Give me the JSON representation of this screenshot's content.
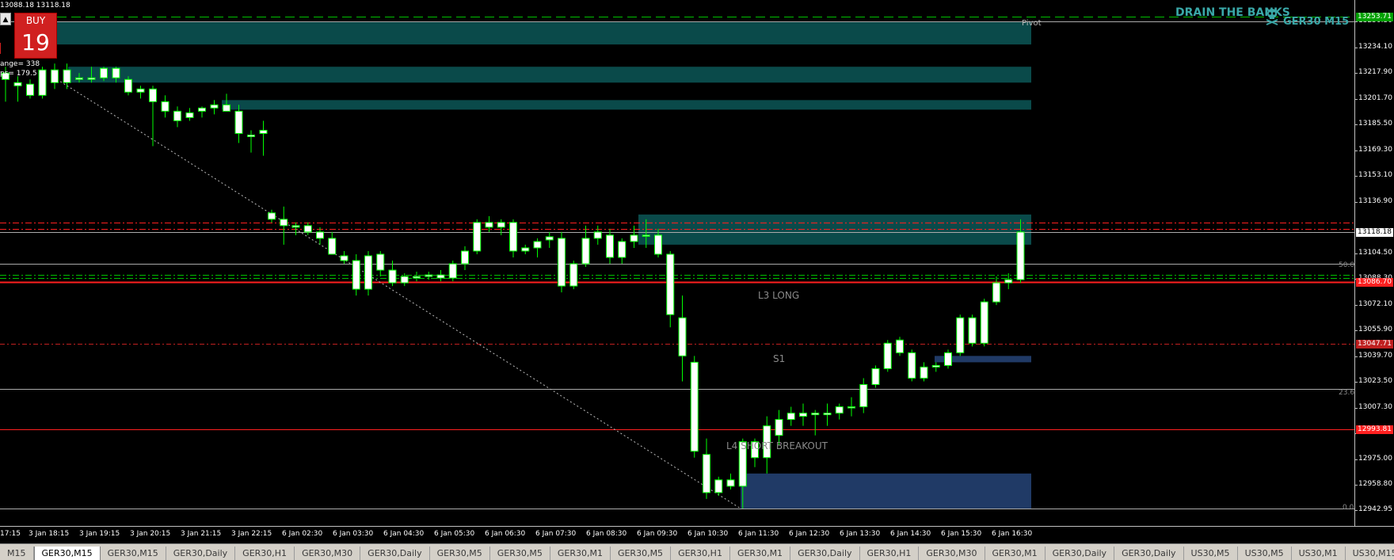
{
  "header": {
    "bid_ask": "13088.18 13118.18"
  },
  "trade_panel": {
    "collapse_icon": "triangle-up-icon",
    "buy_label": "BUY",
    "buy_price_big": "19",
    "buy_price_small": "19",
    "range_text": "ange= 338",
    "pips_text": "ps= 179.5"
  },
  "brand": {
    "name": "DRAIN THE BANKS",
    "icon": "skull-icon",
    "symbol_tf": "GER30 M15"
  },
  "labels": {
    "pivot": "Pivot",
    "l3_long": "L3 LONG",
    "s1": "S1",
    "l4_short": "L4 SHORT BREAKOUT",
    "fib_50": "50.0",
    "fib_236": "23.6",
    "fib_0": "0.0"
  },
  "colors": {
    "bull_candle": "#ffffff",
    "bear_candle": "#ffffff",
    "wick": "#00ff00",
    "supply_zone": "#0a4a4a",
    "demand_zone": "#203a66",
    "red_level": "#ff2020",
    "green_dash": "#00c000",
    "grey_line": "#8a8a8a"
  },
  "price_axis": {
    "ticks": [
      "13250.30",
      "13234.10",
      "13217.90",
      "13201.70",
      "13185.50",
      "13169.30",
      "13153.10",
      "13136.90",
      "13104.50",
      "13088.30",
      "13072.10",
      "13055.90",
      "13039.70",
      "13023.50",
      "13007.30",
      "12991.10",
      "12975.00",
      "12958.80",
      "12942.95"
    ],
    "markers": [
      {
        "value": "13253.71",
        "bg": "#00a000",
        "fg": "#ffffff"
      },
      {
        "value": "13118.18",
        "bg": "#ffffff",
        "fg": "#000000"
      },
      {
        "value": "13086.70",
        "bg": "#ff2020",
        "fg": "#ffffff"
      },
      {
        "value": "13047.71",
        "bg": "#c02020",
        "fg": "#ffffff"
      },
      {
        "value": "12993.81",
        "bg": "#ff2020",
        "fg": "#ffffff"
      }
    ]
  },
  "time_axis": {
    "ticks": [
      "17:15",
      "3 Jan 18:15",
      "3 Jan 19:15",
      "3 Jan 20:15",
      "3 Jan 21:15",
      "3 Jan 22:15",
      "6 Jan 02:30",
      "6 Jan 03:30",
      "6 Jan 04:30",
      "6 Jan 05:30",
      "6 Jan 06:30",
      "6 Jan 07:30",
      "6 Jan 08:30",
      "6 Jan 09:30",
      "6 Jan 10:30",
      "6 Jan 11:30",
      "6 Jan 12:30",
      "6 Jan 13:30",
      "6 Jan 14:30",
      "6 Jan 15:30",
      "6 Jan 16:30"
    ]
  },
  "tabs": [
    {
      "label": "M15",
      "active": false
    },
    {
      "label": "GER30,M15",
      "active": true
    },
    {
      "label": "GER30,M15",
      "active": false
    },
    {
      "label": "GER30,Daily",
      "active": false
    },
    {
      "label": "GER30,H1",
      "active": false
    },
    {
      "label": "GER30,M30",
      "active": false
    },
    {
      "label": "GER30,Daily",
      "active": false
    },
    {
      "label": "GER30,M5",
      "active": false
    },
    {
      "label": "GER30,M5",
      "active": false
    },
    {
      "label": "GER30,M1",
      "active": false
    },
    {
      "label": "GER30,M5",
      "active": false
    },
    {
      "label": "GER30,H1",
      "active": false
    },
    {
      "label": "GER30,M1",
      "active": false
    },
    {
      "label": "GER30,Daily",
      "active": false
    },
    {
      "label": "GER30,H1",
      "active": false
    },
    {
      "label": "GER30,M30",
      "active": false
    },
    {
      "label": "GER30,M1",
      "active": false
    },
    {
      "label": "GER30,Daily",
      "active": false
    },
    {
      "label": "GER30,Daily",
      "active": false
    },
    {
      "label": "US30,M5",
      "active": false
    },
    {
      "label": "US30,M5",
      "active": false
    },
    {
      "label": "US30,M1",
      "active": false
    },
    {
      "label": "US30,M15",
      "active": false
    }
  ],
  "candles": [
    {
      "o": 13214,
      "h": 13222,
      "l": 13200,
      "c": 13218
    },
    {
      "o": 13212,
      "h": 13216,
      "l": 13200,
      "c": 13210
    },
    {
      "o": 13211,
      "h": 13214,
      "l": 13202,
      "c": 13204
    },
    {
      "o": 13204,
      "h": 13222,
      "l": 13202,
      "c": 13220
    },
    {
      "o": 13220,
      "h": 13224,
      "l": 13208,
      "c": 13212
    },
    {
      "o": 13212,
      "h": 13224,
      "l": 13208,
      "c": 13220
    },
    {
      "o": 13214,
      "h": 13218,
      "l": 13212,
      "c": 13215
    },
    {
      "o": 13215,
      "h": 13222,
      "l": 13212,
      "c": 13214
    },
    {
      "o": 13215,
      "h": 13222,
      "l": 13213,
      "c": 13221
    },
    {
      "o": 13221,
      "h": 13222,
      "l": 13212,
      "c": 13215
    },
    {
      "o": 13214,
      "h": 13216,
      "l": 13204,
      "c": 13206
    },
    {
      "o": 13206,
      "h": 13210,
      "l": 13202,
      "c": 13208
    },
    {
      "o": 13208,
      "h": 13210,
      "l": 13172,
      "c": 13200
    },
    {
      "o": 13200,
      "h": 13204,
      "l": 13190,
      "c": 13194
    },
    {
      "o": 13194,
      "h": 13197,
      "l": 13184,
      "c": 13188
    },
    {
      "o": 13190,
      "h": 13196,
      "l": 13188,
      "c": 13193
    },
    {
      "o": 13194,
      "h": 13197,
      "l": 13190,
      "c": 13196
    },
    {
      "o": 13196,
      "h": 13201,
      "l": 13192,
      "c": 13198
    },
    {
      "o": 13198,
      "h": 13205,
      "l": 13196,
      "c": 13194
    },
    {
      "o": 13194,
      "h": 13198,
      "l": 13174,
      "c": 13180
    },
    {
      "o": 13178,
      "h": 13182,
      "l": 13168,
      "c": 13179
    },
    {
      "o": 13180,
      "h": 13188,
      "l": 13166,
      "c": 13182
    },
    {
      "o": 13130,
      "h": 13132,
      "l": 13124,
      "c": 13126
    },
    {
      "o": 13126,
      "h": 13134,
      "l": 13110,
      "c": 13122
    },
    {
      "o": 13121,
      "h": 13124,
      "l": 13116,
      "c": 13122
    },
    {
      "o": 13122,
      "h": 13124,
      "l": 13116,
      "c": 13118
    },
    {
      "o": 13118,
      "h": 13121,
      "l": 13110,
      "c": 13114
    },
    {
      "o": 13114,
      "h": 13118,
      "l": 13108,
      "c": 13104
    },
    {
      "o": 13103,
      "h": 13106,
      "l": 13098,
      "c": 13100
    },
    {
      "o": 13100,
      "h": 13104,
      "l": 13078,
      "c": 13082
    },
    {
      "o": 13082,
      "h": 13106,
      "l": 13078,
      "c": 13103
    },
    {
      "o": 13104,
      "h": 13106,
      "l": 13090,
      "c": 13094
    },
    {
      "o": 13094,
      "h": 13100,
      "l": 13084,
      "c": 13086
    },
    {
      "o": 13086,
      "h": 13092,
      "l": 13084,
      "c": 13090
    },
    {
      "o": 13089,
      "h": 13093,
      "l": 13087,
      "c": 13090
    },
    {
      "o": 13090,
      "h": 13093,
      "l": 13088,
      "c": 13091
    },
    {
      "o": 13091,
      "h": 13094,
      "l": 13087,
      "c": 13089
    },
    {
      "o": 13089,
      "h": 13100,
      "l": 13087,
      "c": 13098
    },
    {
      "o": 13098,
      "h": 13109,
      "l": 13094,
      "c": 13106
    },
    {
      "o": 13106,
      "h": 13126,
      "l": 13104,
      "c": 13124
    },
    {
      "o": 13124,
      "h": 13128,
      "l": 13118,
      "c": 13121
    },
    {
      "o": 13121,
      "h": 13126,
      "l": 13116,
      "c": 13124
    },
    {
      "o": 13124,
      "h": 13126,
      "l": 13102,
      "c": 13106
    },
    {
      "o": 13106,
      "h": 13110,
      "l": 13104,
      "c": 13108
    },
    {
      "o": 13108,
      "h": 13114,
      "l": 13102,
      "c": 13112
    },
    {
      "o": 13113,
      "h": 13118,
      "l": 13108,
      "c": 13115
    },
    {
      "o": 13114,
      "h": 13118,
      "l": 13080,
      "c": 13084
    },
    {
      "o": 13084,
      "h": 13100,
      "l": 13082,
      "c": 13098
    },
    {
      "o": 13098,
      "h": 13122,
      "l": 13096,
      "c": 13114
    },
    {
      "o": 13114,
      "h": 13122,
      "l": 13110,
      "c": 13118
    },
    {
      "o": 13116,
      "h": 13120,
      "l": 13098,
      "c": 13102
    },
    {
      "o": 13102,
      "h": 13114,
      "l": 13098,
      "c": 13112
    },
    {
      "o": 13112,
      "h": 13122,
      "l": 13108,
      "c": 13116
    },
    {
      "o": 13116,
      "h": 13126,
      "l": 13108,
      "c": 13116
    },
    {
      "o": 13116,
      "h": 13120,
      "l": 13102,
      "c": 13104
    },
    {
      "o": 13104,
      "h": 13106,
      "l": 13058,
      "c": 13066
    },
    {
      "o": 13064,
      "h": 13078,
      "l": 13024,
      "c": 13040
    },
    {
      "o": 13036,
      "h": 13040,
      "l": 12976,
      "c": 12980
    },
    {
      "o": 12978,
      "h": 12988,
      "l": 12950,
      "c": 12954
    },
    {
      "o": 12954,
      "h": 12964,
      "l": 12952,
      "c": 12962
    },
    {
      "o": 12962,
      "h": 12966,
      "l": 12956,
      "c": 12958
    },
    {
      "o": 12958,
      "h": 12988,
      "l": 12944,
      "c": 12986
    },
    {
      "o": 12986,
      "h": 12988,
      "l": 12970,
      "c": 12976
    },
    {
      "o": 12976,
      "h": 13002,
      "l": 12966,
      "c": 12996
    },
    {
      "o": 12990,
      "h": 13006,
      "l": 12984,
      "c": 13000
    },
    {
      "o": 13000,
      "h": 13008,
      "l": 12996,
      "c": 13004
    },
    {
      "o": 13002,
      "h": 13010,
      "l": 12996,
      "c": 13004
    },
    {
      "o": 13004,
      "h": 13006,
      "l": 12990,
      "c": 13003
    },
    {
      "o": 13003,
      "h": 13010,
      "l": 12996,
      "c": 13004
    },
    {
      "o": 13004,
      "h": 13010,
      "l": 13000,
      "c": 13008
    },
    {
      "o": 13008,
      "h": 13014,
      "l": 13002,
      "c": 13008
    },
    {
      "o": 13008,
      "h": 13026,
      "l": 13004,
      "c": 13022
    },
    {
      "o": 13022,
      "h": 13034,
      "l": 13020,
      "c": 13032
    },
    {
      "o": 13032,
      "h": 13050,
      "l": 13030,
      "c": 13048
    },
    {
      "o": 13050,
      "h": 13052,
      "l": 13040,
      "c": 13042
    },
    {
      "o": 13042,
      "h": 13044,
      "l": 13024,
      "c": 13026
    },
    {
      "o": 13026,
      "h": 13036,
      "l": 13024,
      "c": 13033
    },
    {
      "o": 13033,
      "h": 13036,
      "l": 13030,
      "c": 13034
    },
    {
      "o": 13034,
      "h": 13044,
      "l": 13032,
      "c": 13042
    },
    {
      "o": 13042,
      "h": 13066,
      "l": 13040,
      "c": 13064
    },
    {
      "o": 13064,
      "h": 13066,
      "l": 13046,
      "c": 13048
    },
    {
      "o": 13048,
      "h": 13076,
      "l": 13046,
      "c": 13074
    },
    {
      "o": 13074,
      "h": 13090,
      "l": 13072,
      "c": 13086
    },
    {
      "o": 13086,
      "h": 13092,
      "l": 13082,
      "c": 13088
    },
    {
      "o": 13088,
      "h": 13126,
      "l": 13086,
      "c": 13118
    }
  ]
}
